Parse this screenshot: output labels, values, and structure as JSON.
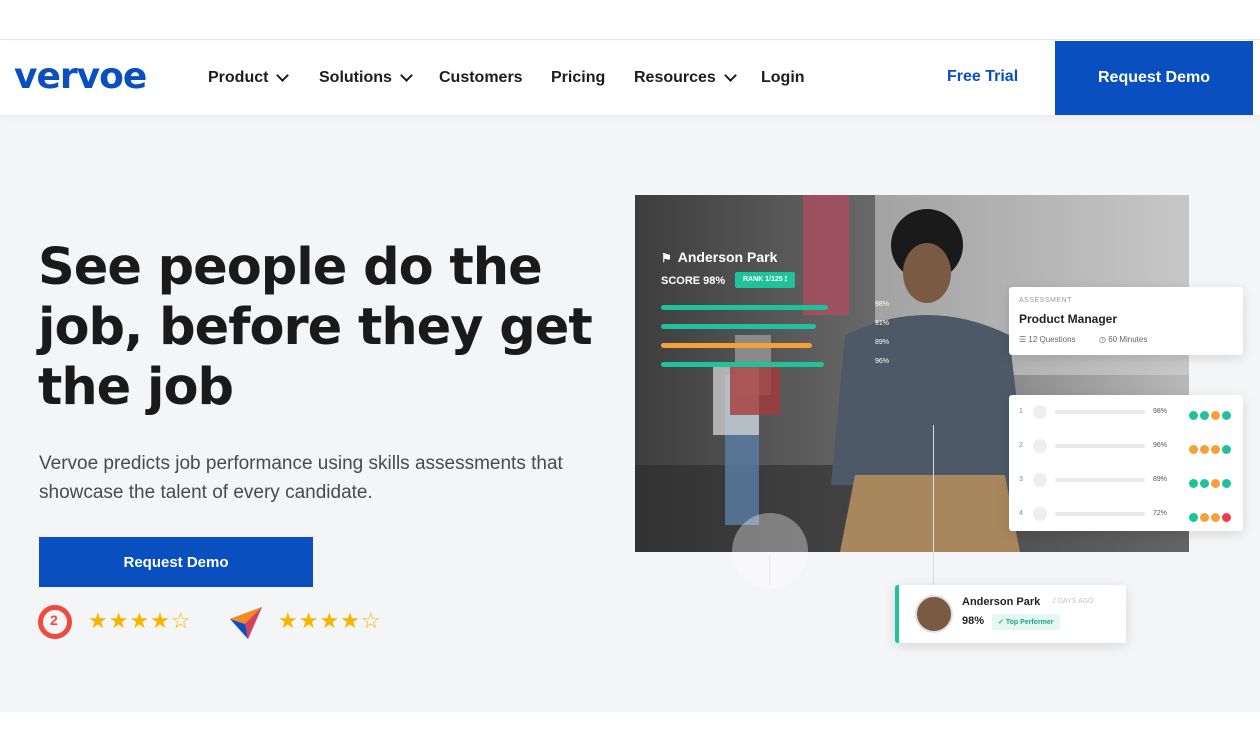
{
  "brand": {
    "logo": "vervoe"
  },
  "nav": {
    "items": [
      {
        "label": "Product",
        "dropdown": true
      },
      {
        "label": "Solutions",
        "dropdown": true
      },
      {
        "label": "Customers",
        "dropdown": false
      },
      {
        "label": "Pricing",
        "dropdown": false
      },
      {
        "label": "Resources",
        "dropdown": true
      },
      {
        "label": "Login",
        "dropdown": false
      }
    ],
    "free_trial": "Free Trial",
    "request_demo": "Request Demo"
  },
  "hero": {
    "headline": "See people do the job, before they get the job",
    "subtext": "Vervoe predicts job performance using skills assessments that showcase the talent of every candidate.",
    "cta": "Request Demo",
    "ratings": [
      {
        "badge": "G2",
        "stars": 4.5
      },
      {
        "badge": "capterra-arrow",
        "stars": 4.5
      }
    ]
  },
  "illustration": {
    "candidate": {
      "name": "Anderson Park",
      "score_label": "SCORE 98%",
      "rank": "RANK 1/125",
      "skills": [
        {
          "value": "98%",
          "fraction": 0.98,
          "color": "#1fc39b"
        },
        {
          "value": "91%",
          "fraction": 0.91,
          "color": "#1fc39b"
        },
        {
          "value": "89%",
          "fraction": 0.89,
          "color": "#f5a13a"
        },
        {
          "value": "96%",
          "fraction": 0.96,
          "color": "#1fc39b"
        }
      ]
    },
    "assessment": {
      "kicker": "ASSESSMENT",
      "title": "Product Manager",
      "questions": "12 Questions",
      "duration": "60 Minutes"
    },
    "leaderboard": [
      {
        "rank": "1",
        "score": "98%",
        "dots": [
          "#1fc39b",
          "#1fc39b",
          "#f5a13a",
          "#1fc39b"
        ]
      },
      {
        "rank": "2",
        "score": "96%",
        "dots": [
          "#f5a13a",
          "#f5a13a",
          "#f5a13a",
          "#1fc39b"
        ]
      },
      {
        "rank": "3",
        "score": "89%",
        "dots": [
          "#1fc39b",
          "#1fc39b",
          "#f5a13a",
          "#1fc39b"
        ]
      },
      {
        "rank": "4",
        "score": "72%",
        "dots": [
          "#1fc39b",
          "#f5a13a",
          "#f5a13a",
          "#ef3b4b"
        ]
      }
    ],
    "notification": {
      "name": "Anderson Park",
      "time": "2 DAYS AGO",
      "score": "98%",
      "badge": "Top Performer"
    }
  },
  "colors": {
    "brand_blue": "#0a4fbf",
    "teal": "#1fc39b",
    "orange": "#f5a13a",
    "hero_bg": "#f4f5f7"
  }
}
